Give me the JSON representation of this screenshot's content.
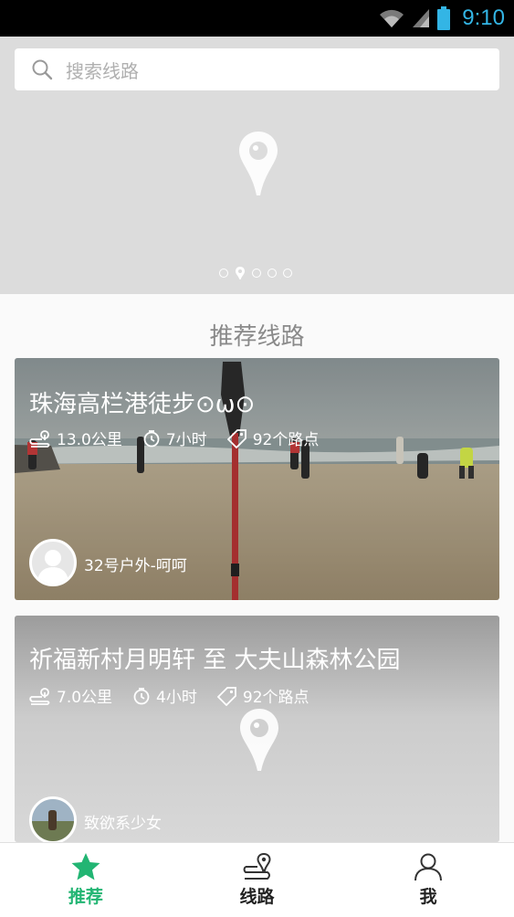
{
  "status_bar": {
    "time": "9:10",
    "icons": [
      "wifi-icon",
      "signal-icon",
      "battery-icon"
    ]
  },
  "search": {
    "placeholder": "搜索线路"
  },
  "banner": {
    "page_count": 5,
    "active_page": 2
  },
  "section": {
    "title": "推荐线路"
  },
  "routes": [
    {
      "title": "珠海高栏港徒步⊙ω⊙",
      "distance": "13.0公里",
      "duration": "7小时",
      "waypoints": "92个路点",
      "author": "32号户外-呵呵"
    },
    {
      "title": "祈福新村月明轩 至 大夫山森林公园",
      "distance": "7.0公里",
      "duration": "4小时",
      "waypoints": "92个路点",
      "author": "致欲系少女"
    }
  ],
  "tabs": [
    {
      "label": "推荐",
      "icon": "star-icon",
      "active": true
    },
    {
      "label": "线路",
      "icon": "route-icon",
      "active": false
    },
    {
      "label": "我",
      "icon": "person-icon",
      "active": false
    }
  ],
  "colors": {
    "accent": "#22b573",
    "status_time": "#33b5e5"
  }
}
